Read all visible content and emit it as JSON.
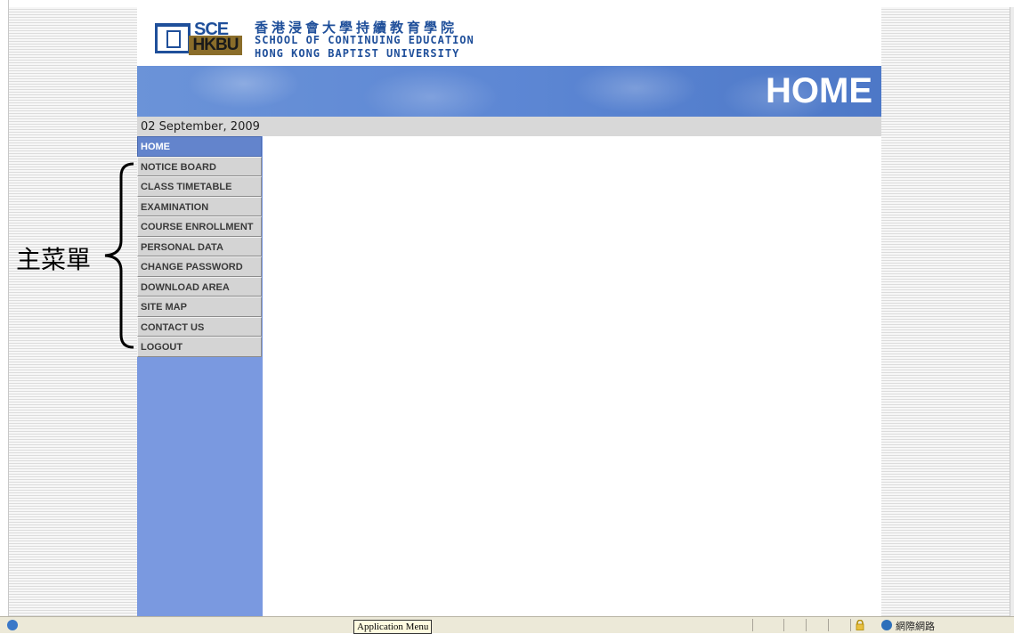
{
  "header": {
    "logo_sce": "SCE",
    "logo_hkbu": "HKBU",
    "school_chinese": "香港浸會大學持續教育學院",
    "school_english_line1": "SCHOOL OF CONTINUING EDUCATION",
    "school_english_line2": "HONG KONG BAPTIST UNIVERSITY"
  },
  "banner": {
    "title": "HOME"
  },
  "date": "02 September, 2009",
  "nav": {
    "items": [
      {
        "label": "HOME",
        "active": true
      },
      {
        "label": "NOTICE BOARD"
      },
      {
        "label": "CLASS TIMETABLE"
      },
      {
        "label": "EXAMINATION"
      },
      {
        "label": "COURSE ENROLLMENT"
      },
      {
        "label": "PERSONAL DATA"
      },
      {
        "label": "CHANGE PASSWORD"
      },
      {
        "label": "DOWNLOAD AREA"
      },
      {
        "label": "SITE MAP"
      },
      {
        "label": "CONTACT US"
      },
      {
        "label": "LOGOUT"
      }
    ]
  },
  "annotation": {
    "label": "主菜單"
  },
  "statusbar": {
    "tooltip": "Application Menu",
    "zone": "網際網路"
  },
  "colors": {
    "banner": "#5d87d4",
    "nav_background": "#7a99e0",
    "nav_active": "#6384cc",
    "nav_item": "#d4d4d4",
    "logo_blue": "#1f4f9a",
    "logo_gold": "#8a6d2a"
  }
}
